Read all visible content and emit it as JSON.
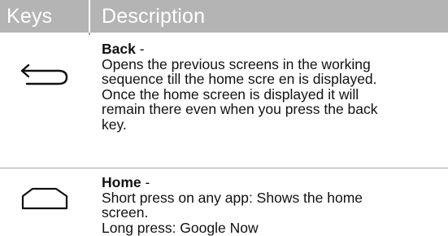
{
  "table": {
    "headers": {
      "keys": "Keys",
      "description": "Description"
    },
    "rows": [
      {
        "icon": "back-arrow-icon",
        "title": "Back",
        "separator": " -",
        "description_lines": [
          "Opens the previous screens in the working",
          "sequence till the home scre  en is displayed.",
          "Once the home screen is displayed it will",
          "remain there even when you press the back",
          "key."
        ]
      },
      {
        "icon": "home-outline-icon",
        "title": "Home",
        "separator": " -",
        "description_lines": [
          "Short press on any app: Shows the home",
          "screen.",
          "Long press: Google Now"
        ]
      }
    ]
  },
  "colors": {
    "header_background": "#b4b4b4",
    "header_text": "#ffffff",
    "body_text": "#111111",
    "grid_lines": "#a8a8a8",
    "icon_stroke": "#111111"
  }
}
